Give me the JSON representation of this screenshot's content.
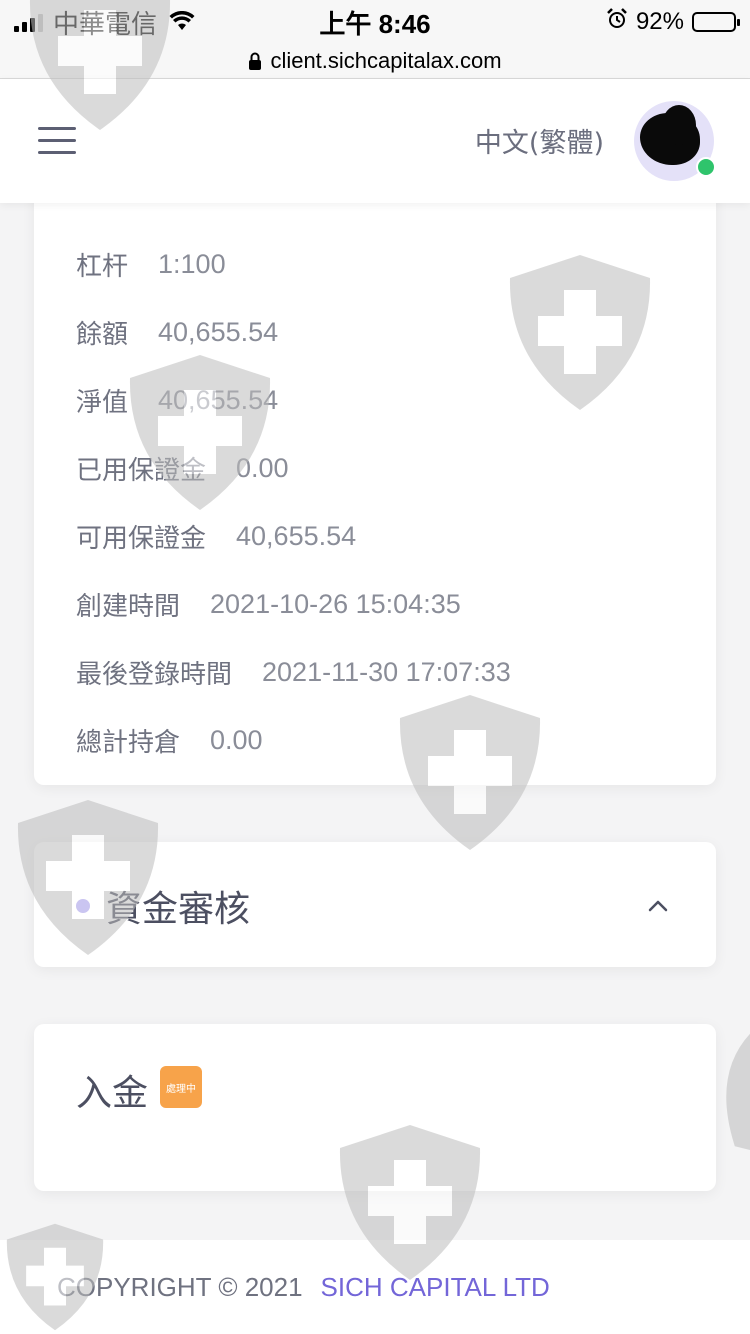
{
  "status_bar": {
    "carrier": "中華電信",
    "time": "上午 8:46",
    "battery": "92%",
    "battery_level": 0.92
  },
  "browser": {
    "url": "client.sichcapitalax.com"
  },
  "header": {
    "language": "中文(繁體)"
  },
  "account_info": [
    {
      "label": "杠杆",
      "value": "1:100"
    },
    {
      "label": "餘額",
      "value": "40,655.54"
    },
    {
      "label": "淨值",
      "value": "40,655.54"
    },
    {
      "label": "已用保證金",
      "value": "0.00"
    },
    {
      "label": "可用保證金",
      "value": "40,655.54"
    },
    {
      "label": "創建時間",
      "value": "2021-10-26 15:04:35"
    },
    {
      "label": "最後登錄時間",
      "value": "2021-11-30 17:07:33"
    },
    {
      "label": "總計持倉",
      "value": "0.00"
    }
  ],
  "fund_review": {
    "title": "資金審核"
  },
  "deposit": {
    "label": "入金",
    "status_badge": "處理中"
  },
  "footer": {
    "copyright": "COPYRIGHT © 2021",
    "company": "SICH CAPITAL LTD"
  },
  "colors": {
    "accent": "#7366d8",
    "badge": "#f7a34a",
    "online": "#2fc46c"
  },
  "icons": [
    "signal-icon",
    "wifi-icon",
    "alarm-icon",
    "battery-icon",
    "lock-icon",
    "menu-icon",
    "chevron-up-icon",
    "shield-cross-watermark"
  ]
}
